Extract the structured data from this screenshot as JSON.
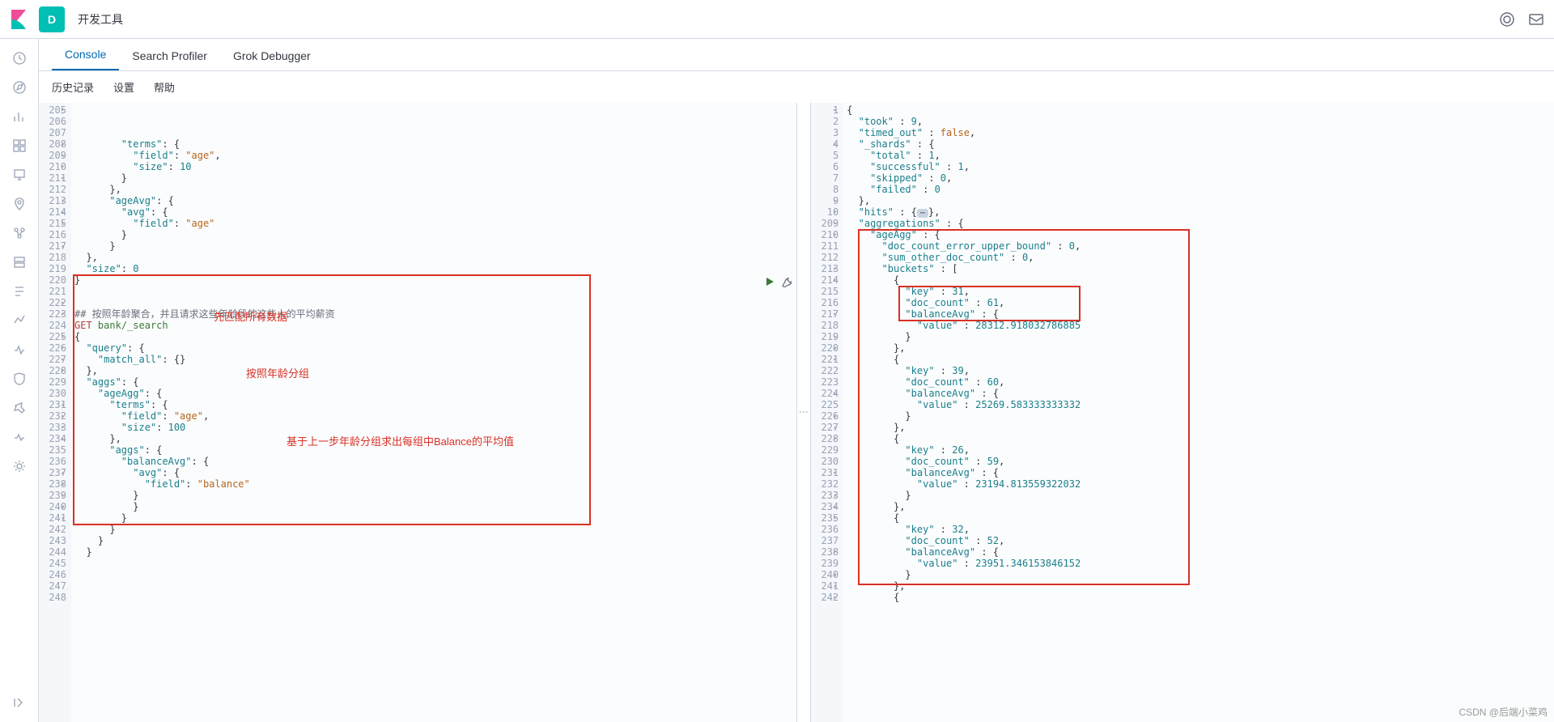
{
  "topbar": {
    "space_letter": "D",
    "breadcrumb": "开发工具"
  },
  "tabs": {
    "console": "Console",
    "search_profiler": "Search Profiler",
    "grok": "Grok Debugger"
  },
  "subnav": {
    "history": "历史记录",
    "settings": "设置",
    "help": "帮助"
  },
  "annotations": {
    "comment": "## 按照年龄聚合，并且请求这些年龄段的这些人的平均薪资",
    "a1": "先匹配所有数据",
    "a2": "按照年龄分组",
    "a3": "基于上一步年龄分组求出每组中Balance的平均值"
  },
  "watermark": "CSDN @后端小菜鸡",
  "request_lines": [
    {
      "n": 205,
      "f": "▸",
      "html": "        <span class='tok-key'>\"terms\"</span>: {"
    },
    {
      "n": 206,
      "f": "",
      "html": "          <span class='tok-key'>\"field\"</span>: <span class='tok-str'>\"age\"</span>,"
    },
    {
      "n": 207,
      "f": "",
      "html": "          <span class='tok-key'>\"size\"</span>: <span class='tok-num'>10</span>"
    },
    {
      "n": 208,
      "f": "▴",
      "html": "        }"
    },
    {
      "n": 209,
      "f": "▴",
      "html": "      },"
    },
    {
      "n": 210,
      "f": "▸",
      "html": "      <span class='tok-key'>\"ageAvg\"</span>: {"
    },
    {
      "n": 211,
      "f": "▸",
      "html": "        <span class='tok-key'>\"avg\"</span>: {"
    },
    {
      "n": 212,
      "f": "",
      "html": "          <span class='tok-key'>\"field\"</span>: <span class='tok-str'>\"age\"</span>"
    },
    {
      "n": 213,
      "f": "▴",
      "html": "        }"
    },
    {
      "n": 214,
      "f": "▴",
      "html": "      }"
    },
    {
      "n": 215,
      "f": "▴",
      "html": "  },"
    },
    {
      "n": 216,
      "f": "",
      "html": "  <span class='tok-key'>\"size\"</span>: <span class='tok-num'>0</span>"
    },
    {
      "n": 217,
      "f": "▴",
      "html": "}"
    },
    {
      "n": 218,
      "f": "",
      "html": ""
    },
    {
      "n": 219,
      "f": "",
      "html": ""
    },
    {
      "n": 220,
      "f": "",
      "html": "<span class='tok-comment' data-bind='annotations.comment'></span>"
    },
    {
      "n": 221,
      "f": "",
      "html": "<span class='tok-method'>GET</span> <span class='tok-path'>bank/_search</span>"
    },
    {
      "n": 222,
      "f": "▸",
      "html": "{"
    },
    {
      "n": 223,
      "f": "▸",
      "html": "  <span class='tok-key'>\"query\"</span>: {"
    },
    {
      "n": 224,
      "f": "",
      "html": "    <span class='tok-key'>\"match_all\"</span>: {}"
    },
    {
      "n": 225,
      "f": "▴",
      "html": "  },"
    },
    {
      "n": 226,
      "f": "▸",
      "html": "  <span class='tok-key'>\"aggs\"</span>: {"
    },
    {
      "n": 227,
      "f": "▸",
      "html": "    <span class='tok-key'>\"ageAgg\"</span>: {"
    },
    {
      "n": 228,
      "f": "▸",
      "html": "      <span class='tok-key'>\"terms\"</span>: {"
    },
    {
      "n": 229,
      "f": "",
      "html": "        <span class='tok-key'>\"field\"</span>: <span class='tok-str'>\"age\"</span>,"
    },
    {
      "n": 230,
      "f": "",
      "html": "        <span class='tok-key'>\"size\"</span>: <span class='tok-num'>100</span>"
    },
    {
      "n": 231,
      "f": "▴",
      "html": "      },"
    },
    {
      "n": 232,
      "f": "▸",
      "html": "      <span class='tok-key'>\"aggs\"</span>: {"
    },
    {
      "n": 233,
      "f": "▸",
      "html": "        <span class='tok-key'>\"balanceAvg\"</span>: {"
    },
    {
      "n": 234,
      "f": "▸",
      "html": "          <span class='tok-key'>\"avg\"</span>: {"
    },
    {
      "n": 235,
      "f": "",
      "html": "            <span class='tok-key'>\"field\"</span>: <span class='tok-str'>\"balance\"</span>"
    },
    {
      "n": 236,
      "f": "",
      "html": "          }"
    },
    {
      "n": 237,
      "f": "▴",
      "html": "          }"
    },
    {
      "n": 238,
      "f": "▴",
      "html": "        }"
    },
    {
      "n": 239,
      "f": "▴",
      "html": "      }"
    },
    {
      "n": 240,
      "f": "▴",
      "html": "    }"
    },
    {
      "n": 241,
      "f": "▴",
      "html": "  }"
    },
    {
      "n": 242,
      "f": "",
      "html": ""
    },
    {
      "n": 243,
      "f": "",
      "html": ""
    },
    {
      "n": 244,
      "f": "",
      "html": ""
    },
    {
      "n": 245,
      "f": "",
      "html": ""
    },
    {
      "n": 246,
      "f": "",
      "html": ""
    },
    {
      "n": 247,
      "f": "",
      "html": ""
    },
    {
      "n": 248,
      "f": "",
      "html": ""
    }
  ],
  "response_lines": [
    {
      "n": 1,
      "f": "▸",
      "html": "{"
    },
    {
      "n": 2,
      "f": "",
      "html": "  <span class='tok-key'>\"took\"</span> : <span class='tok-num'>9</span>,"
    },
    {
      "n": 3,
      "f": "",
      "html": "  <span class='tok-key'>\"timed_out\"</span> : <span class='tok-bool'>false</span>,"
    },
    {
      "n": 4,
      "f": "▸",
      "html": "  <span class='tok-key'>\"_shards\"</span> : {"
    },
    {
      "n": 5,
      "f": "",
      "html": "    <span class='tok-key'>\"total\"</span> : <span class='tok-num'>1</span>,"
    },
    {
      "n": 6,
      "f": "",
      "html": "    <span class='tok-key'>\"successful\"</span> : <span class='tok-num'>1</span>,"
    },
    {
      "n": 7,
      "f": "",
      "html": "    <span class='tok-key'>\"skipped\"</span> : <span class='tok-num'>0</span>,"
    },
    {
      "n": 8,
      "f": "",
      "html": "    <span class='tok-key'>\"failed\"</span> : <span class='tok-num'>0</span>"
    },
    {
      "n": 9,
      "f": "▴",
      "html": "  },"
    },
    {
      "n": 10,
      "f": "▸",
      "html": "  <span class='tok-key'>\"hits\"</span> : {<span class='collapsed-badge'>&#8943;</span>},"
    },
    {
      "n": 209,
      "f": "▸",
      "html": "  <span class='tok-key'>\"aggregations\"</span> : {"
    },
    {
      "n": 210,
      "f": "▸",
      "html": "    <span class='tok-key'>\"ageAgg\"</span> : {"
    },
    {
      "n": 211,
      "f": "",
      "html": "      <span class='tok-key'>\"doc_count_error_upper_bound\"</span> : <span class='tok-num'>0</span>,"
    },
    {
      "n": 212,
      "f": "",
      "html": "      <span class='tok-key'>\"sum_other_doc_count\"</span> : <span class='tok-num'>0</span>,"
    },
    {
      "n": 213,
      "f": "▸",
      "html": "      <span class='tok-key'>\"buckets\"</span> : ["
    },
    {
      "n": 214,
      "f": "▸",
      "html": "        {"
    },
    {
      "n": 215,
      "f": "",
      "html": "          <span class='tok-key'>\"key\"</span> : <span class='tok-num'>31</span>,"
    },
    {
      "n": 216,
      "f": "",
      "html": "          <span class='tok-key'>\"doc_count\"</span> : <span class='tok-num'>61</span>,"
    },
    {
      "n": 217,
      "f": "▸",
      "html": "          <span class='tok-key'>\"balanceAvg\"</span> : {"
    },
    {
      "n": 218,
      "f": "",
      "html": "            <span class='tok-key'>\"value\"</span> : <span class='tok-num'>28312.918032786885</span>"
    },
    {
      "n": 219,
      "f": "▴",
      "html": "          }"
    },
    {
      "n": 220,
      "f": "▴",
      "html": "        },"
    },
    {
      "n": 221,
      "f": "▸",
      "html": "        {"
    },
    {
      "n": 222,
      "f": "",
      "html": "          <span class='tok-key'>\"key\"</span> : <span class='tok-num'>39</span>,"
    },
    {
      "n": 223,
      "f": "",
      "html": "          <span class='tok-key'>\"doc_count\"</span> : <span class='tok-num'>60</span>,"
    },
    {
      "n": 224,
      "f": "▸",
      "html": "          <span class='tok-key'>\"balanceAvg\"</span> : {"
    },
    {
      "n": 225,
      "f": "",
      "html": "            <span class='tok-key'>\"value\"</span> : <span class='tok-num'>25269.583333333332</span>"
    },
    {
      "n": 226,
      "f": "▴",
      "html": "          }"
    },
    {
      "n": 227,
      "f": "▴",
      "html": "        },"
    },
    {
      "n": 228,
      "f": "▸",
      "html": "        {"
    },
    {
      "n": 229,
      "f": "",
      "html": "          <span class='tok-key'>\"key\"</span> : <span class='tok-num'>26</span>,"
    },
    {
      "n": 230,
      "f": "",
      "html": "          <span class='tok-key'>\"doc_count\"</span> : <span class='tok-num'>59</span>,"
    },
    {
      "n": 231,
      "f": "▸",
      "html": "          <span class='tok-key'>\"balanceAvg\"</span> : {"
    },
    {
      "n": 232,
      "f": "",
      "html": "            <span class='tok-key'>\"value\"</span> : <span class='tok-num'>23194.813559322032</span>"
    },
    {
      "n": 233,
      "f": "▴",
      "html": "          }"
    },
    {
      "n": 234,
      "f": "▴",
      "html": "        },"
    },
    {
      "n": 235,
      "f": "▸",
      "html": "        {"
    },
    {
      "n": 236,
      "f": "",
      "html": "          <span class='tok-key'>\"key\"</span> : <span class='tok-num'>32</span>,"
    },
    {
      "n": 237,
      "f": "",
      "html": "          <span class='tok-key'>\"doc_count\"</span> : <span class='tok-num'>52</span>,"
    },
    {
      "n": 238,
      "f": "▸",
      "html": "          <span class='tok-key'>\"balanceAvg\"</span> : {"
    },
    {
      "n": 239,
      "f": "",
      "html": "            <span class='tok-key'>\"value\"</span> : <span class='tok-num'>23951.346153846152</span>"
    },
    {
      "n": 240,
      "f": "▴",
      "html": "          }"
    },
    {
      "n": 241,
      "f": "▴",
      "html": "        },"
    },
    {
      "n": 242,
      "f": "▸",
      "html": "        {"
    }
  ]
}
